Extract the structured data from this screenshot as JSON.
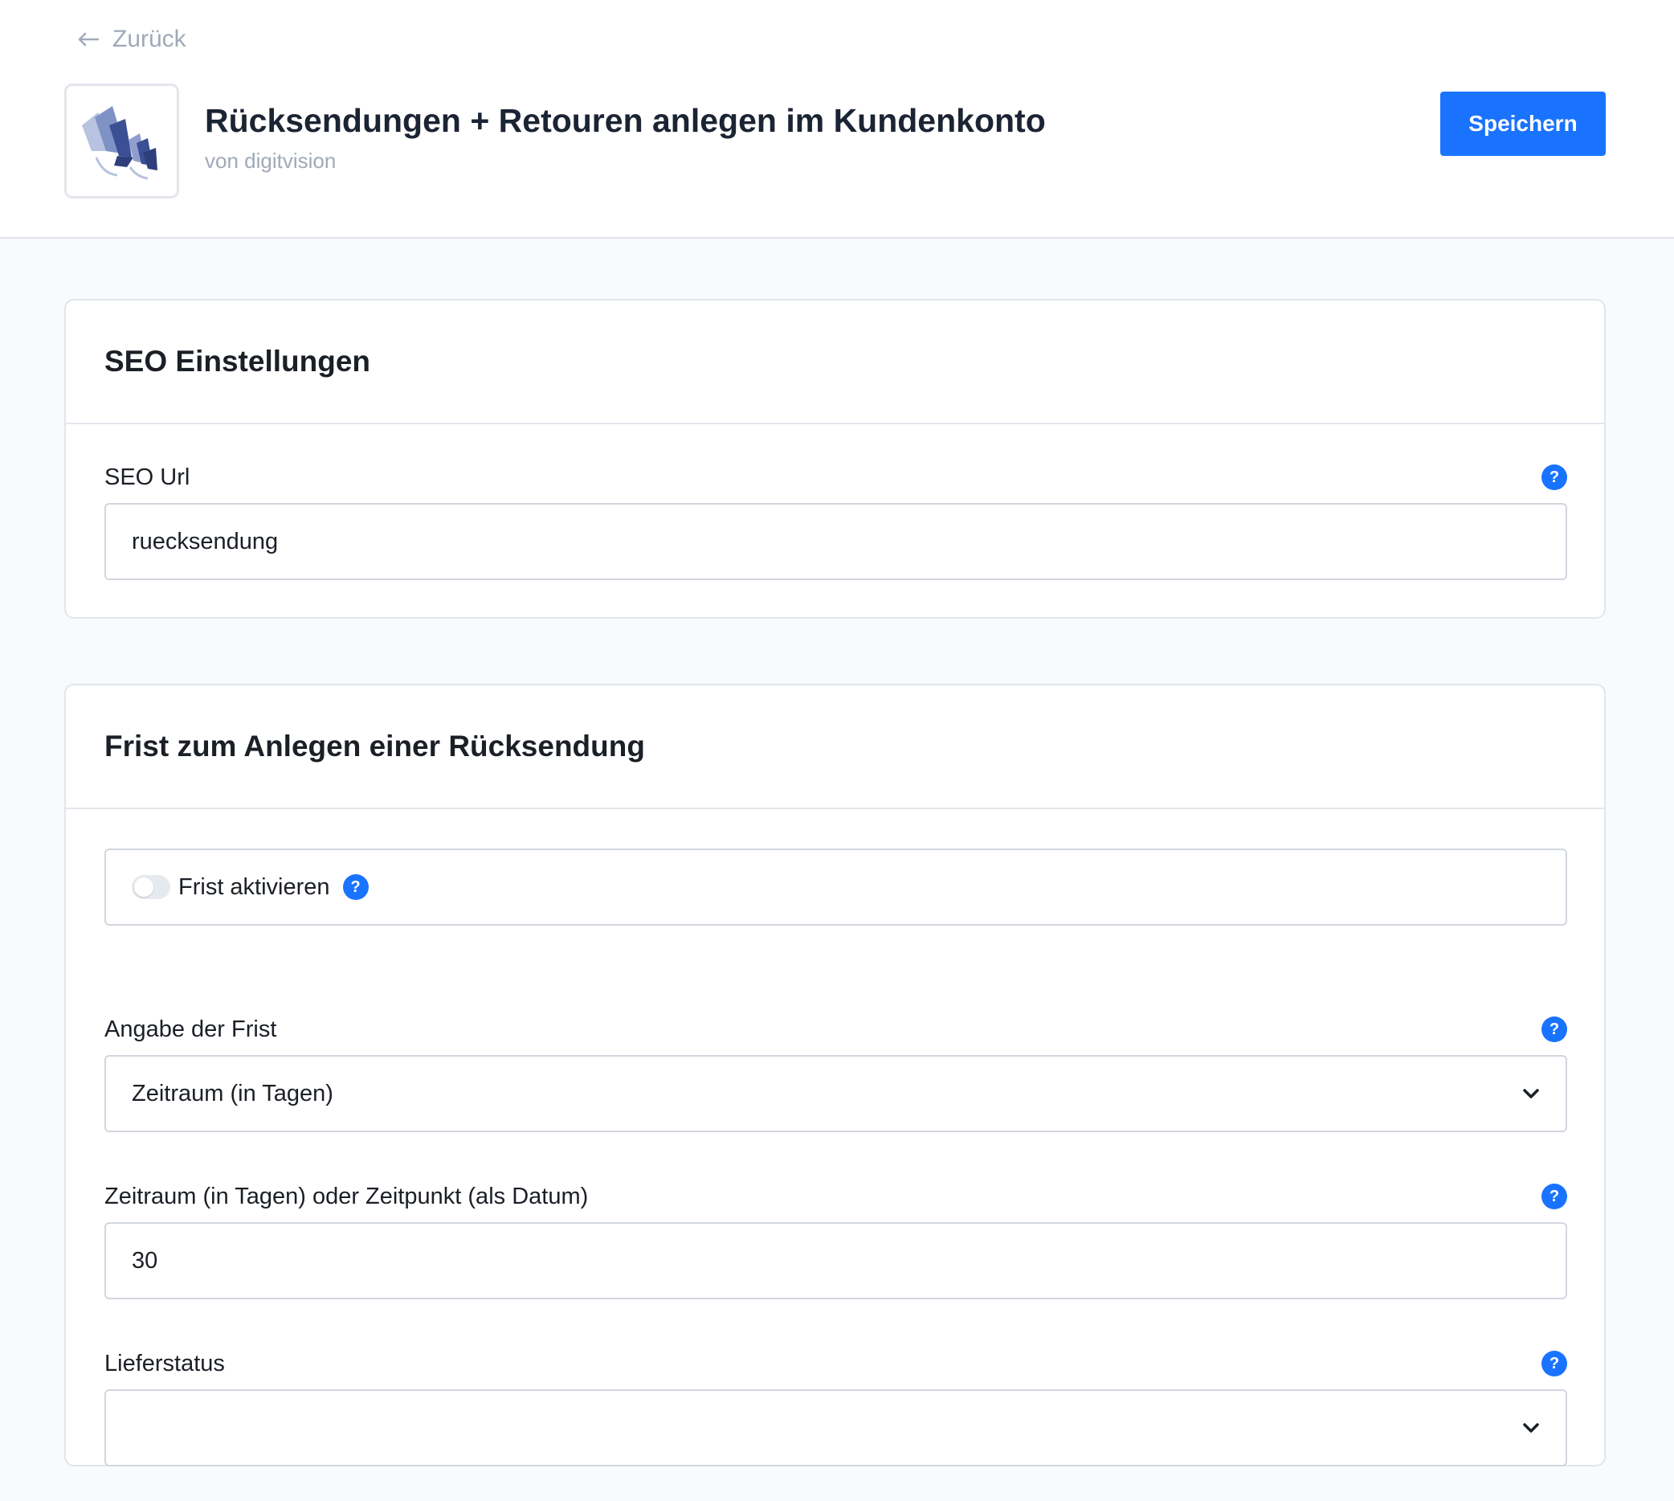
{
  "header": {
    "back_label": "Zurück",
    "title": "Rücksendungen + Retouren anlegen im Kundenkonto",
    "vendor": "von digitvision",
    "save_label": "Speichern"
  },
  "seo_card": {
    "title": "SEO Einstellungen",
    "seo_url": {
      "label": "SEO Url",
      "value": "ruecksendung",
      "help": "?"
    }
  },
  "deadline_card": {
    "title": "Frist zum Anlegen einer Rücksendung",
    "toggle": {
      "label": "Frist aktivieren",
      "enabled": false,
      "help": "?"
    },
    "deadline_type": {
      "label": "Angabe der Frist",
      "selected": "Zeitraum (in Tagen)",
      "help": "?"
    },
    "deadline_value": {
      "label": "Zeitraum (in Tagen) oder Zeitpunkt (als Datum)",
      "value": "30",
      "help": "?"
    },
    "delivery_status": {
      "label": "Lieferstatus",
      "selected": "",
      "help": "?"
    }
  },
  "colors": {
    "primary": "#1a73ff",
    "background": "#f8fafd",
    "border": "#d1d6de",
    "muted_text": "#a0a9b8"
  },
  "icons": [
    "arrow-left-icon",
    "help-icon",
    "chevron-down-icon",
    "app-logo"
  ]
}
